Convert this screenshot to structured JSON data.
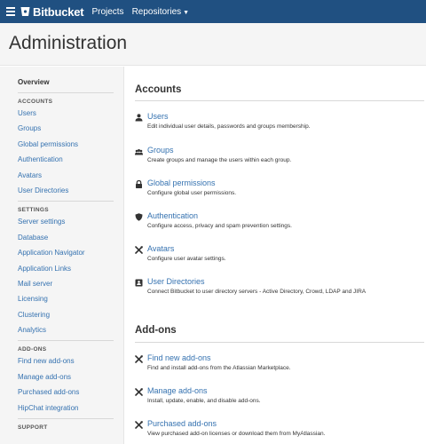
{
  "topbar": {
    "logo_text": "Bitbucket",
    "projects_label": "Projects",
    "repositories_label": "Repositories"
  },
  "page": {
    "title": "Administration"
  },
  "sidebar": {
    "overview_label": "Overview",
    "sections": [
      {
        "heading": "ACCOUNTS",
        "items": [
          "Users",
          "Groups",
          "Global permissions",
          "Authentication",
          "Avatars",
          "User Directories"
        ]
      },
      {
        "heading": "SETTINGS",
        "items": [
          "Server settings",
          "Database",
          "Application Navigator",
          "Application Links",
          "Mail server",
          "Licensing",
          "Clustering",
          "Analytics"
        ]
      },
      {
        "heading": "ADD-ONS",
        "items": [
          "Find new add-ons",
          "Manage add-ons",
          "Purchased add-ons",
          "HipChat integration"
        ]
      },
      {
        "heading": "SUPPORT",
        "items": []
      }
    ]
  },
  "main": {
    "accounts": {
      "title": "Accounts",
      "entries": [
        {
          "icon": "user-icon",
          "title": "Users",
          "description": "Edit individual user details, passwords and groups membership."
        },
        {
          "icon": "group-icon",
          "title": "Groups",
          "description": "Create groups and manage the users within each group."
        },
        {
          "icon": "lock-icon",
          "title": "Global permissions",
          "description": "Configure global user permissions."
        },
        {
          "icon": "shield-icon",
          "title": "Authentication",
          "description": "Configure access, privacy and spam prevention settings."
        },
        {
          "icon": "tools-icon",
          "title": "Avatars",
          "description": "Configure user avatar settings."
        },
        {
          "icon": "directory-icon",
          "title": "User Directories",
          "description": "Connect Bitbucket to user directory servers - Active Directory, Crowd, LDAP and JIRA"
        }
      ]
    },
    "addons": {
      "title": "Add-ons",
      "entries": [
        {
          "icon": "tools-icon",
          "title": "Find new add-ons",
          "description": "Find and install add-ons from the Atlassian Marketplace."
        },
        {
          "icon": "tools-icon",
          "title": "Manage add-ons",
          "description": "Install, update, enable, and disable add-ons."
        },
        {
          "icon": "tools-icon",
          "title": "Purchased add-ons",
          "description": "View purchased add-on licenses or download them from MyAtlassian."
        }
      ]
    }
  },
  "colors": {
    "brand": "#205081",
    "link": "#3572b0",
    "sidebar_bg": "#f5f5f5"
  }
}
